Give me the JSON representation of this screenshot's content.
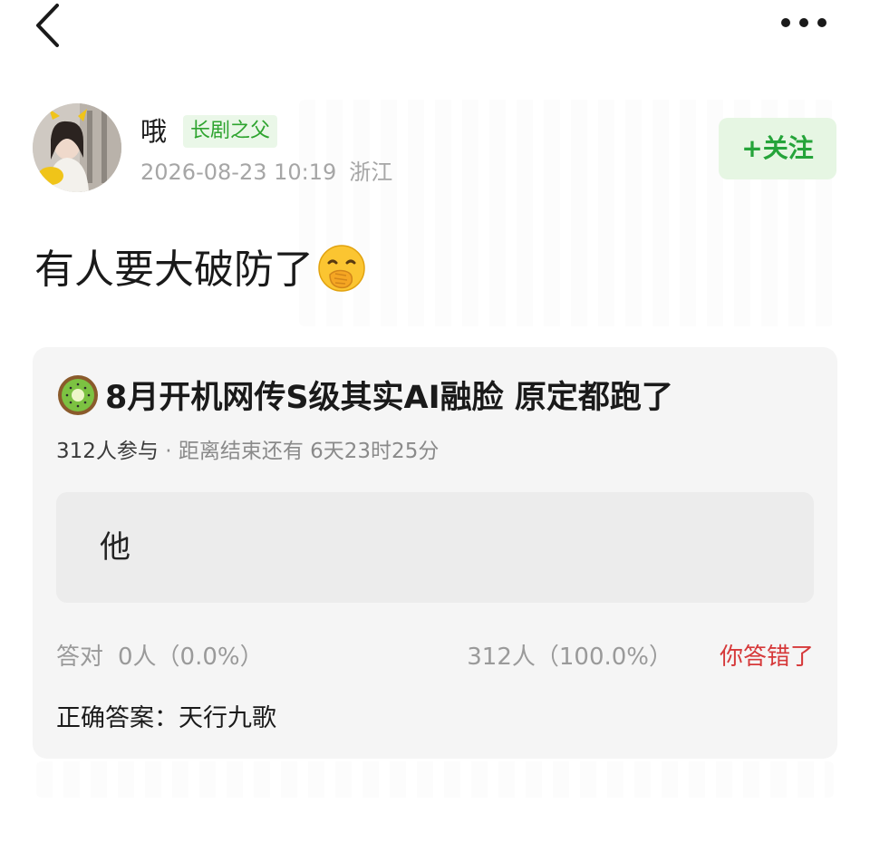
{
  "topbar": {
    "back_icon": "chevron-left-icon",
    "more_icon": "more-horizontal-icon"
  },
  "author": {
    "name": "哦",
    "badge": "长剧之父",
    "timestamp": "2026-08-23 10:19",
    "location": "浙江",
    "follow_label": "+关注"
  },
  "post": {
    "text": "有人要大破防了",
    "emoji": "face-with-hand-over-mouth"
  },
  "quiz": {
    "icon": "kiwi-emoji",
    "title": "8月开机网传S级其实AI融脸 原定都跑了",
    "participants": "312人参与",
    "separator": "·",
    "time_left": "距离结束还有 6天23时25分",
    "option_label": "他",
    "correct_label": "答对",
    "correct_count": "0人（0.0%）",
    "wrong_count": "312人（100.0%）",
    "wrong_tag": "你答错了",
    "answer": "正确答案：天行九歌"
  },
  "colors": {
    "accent_green": "#2ea42f",
    "wrong_red": "#d6393a"
  }
}
